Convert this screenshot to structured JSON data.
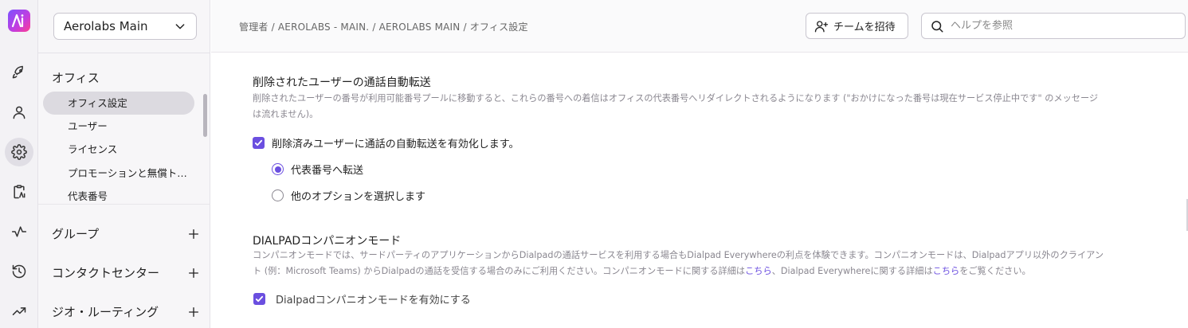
{
  "rail": {
    "items": [
      {
        "name": "rocket-icon",
        "active": false
      },
      {
        "name": "person-icon",
        "active": false
      },
      {
        "name": "gear-icon",
        "active": true
      },
      {
        "name": "clipboard-icon",
        "active": false
      },
      {
        "name": "activity-icon",
        "active": false
      },
      {
        "name": "history-icon",
        "active": false
      },
      {
        "name": "trending-icon",
        "active": false
      }
    ]
  },
  "nav": {
    "office_name": "Aerolabs Main",
    "office_section": "オフィス",
    "items": [
      {
        "label": "オフィス設定",
        "active": true
      },
      {
        "label": "ユーザー",
        "active": false
      },
      {
        "label": "ライセンス",
        "active": false
      },
      {
        "label": "プロモーションと無償トライアル",
        "active": false
      },
      {
        "label": "代表番号",
        "active": false
      }
    ],
    "groups": [
      {
        "label": "グループ"
      },
      {
        "label": "コンタクトセンター"
      },
      {
        "label": "ジオ・ルーティング"
      }
    ]
  },
  "header": {
    "breadcrumb": "管理者 / AEROLABS - MAIN. / AEROLABS MAIN / オフィス設定",
    "invite_label": "チームを招待",
    "help_placeholder": "ヘルプを参照"
  },
  "settings": {
    "forwarding": {
      "title": "削除されたユーザーの通話自動転送",
      "description_line1": "削除されたユーザーの番号が利用可能番号プールに移動すると、これらの番号への着信はオフィスの代表番号へリダイレクトされるようになります (\"おかけになった番号は現在サービス停止中です\" のメッセージ",
      "description_line2": "は流れません)。",
      "checkbox_label": "削除済みユーザーに通話の自動転送を有効化します。",
      "checked": true,
      "options": [
        {
          "label": "代表番号へ転送",
          "selected": true
        },
        {
          "label": "他のオプションを選択します",
          "selected": false
        }
      ]
    },
    "companion": {
      "title": "DIALPADコンパニオンモード",
      "description_line1": "コンパニオンモードでは、サードパーティのアプリケーションからDialpadの通話サービスを利用する場合もDialpad Everywhereの利点を体験できます。コンパニオンモードは、Dialpadアプリ以外のクライアン",
      "description_line2_a": "ト (例：Microsoft Teams) からDialpadの通話を受信する場合のみにご利用ください。コンパニオンモードに関する詳細は",
      "link1": "こちら",
      "description_line2_b": "、Dialpad Everywhereに関する詳細は",
      "link2": "こちら",
      "description_line2_c": "をご覧ください。",
      "checkbox_label": "Dialpadコンパニオンモードを有効にする",
      "checked": true
    }
  },
  "colors": {
    "accent": "#6b4fe0",
    "nav_active": "#dcdae0"
  }
}
